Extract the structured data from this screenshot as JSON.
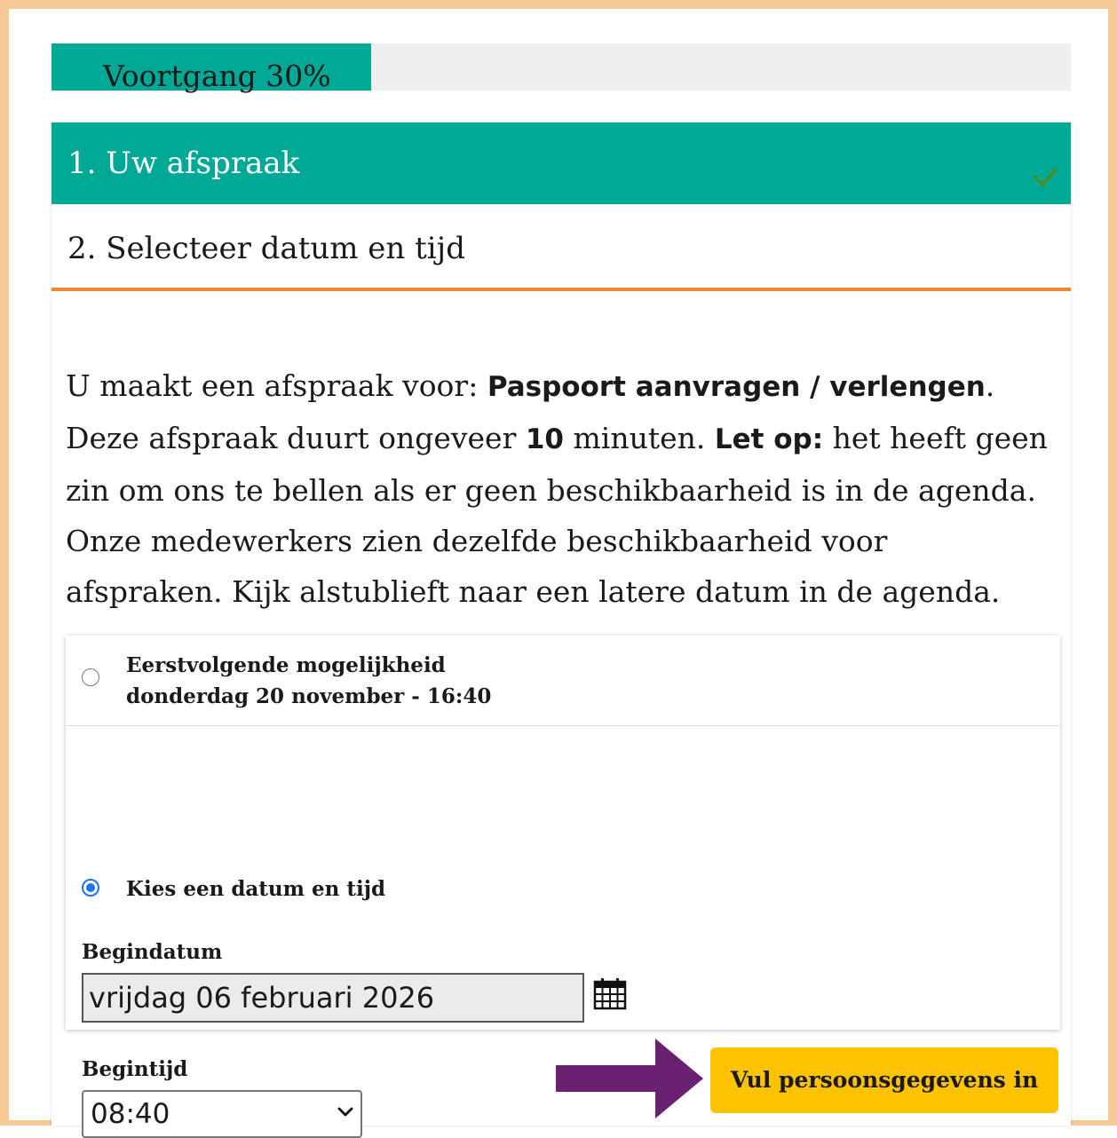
{
  "progress": {
    "label": "Voortgang 30%",
    "percent": 30
  },
  "steps": {
    "step1_label": "1. Uw afspraak",
    "step1_status": "completed",
    "step2_label": "2. Selecteer datum en tijd"
  },
  "intro": {
    "part1": "U maakt een afspraak voor: ",
    "service": "Paspoort aanvragen / verlengen",
    "part2": ". Deze afspraak duurt ongeveer ",
    "duration": "10",
    "part3": " minuten. ",
    "note_label": "Let op:",
    "part4": " het heeft geen zin om ons te bellen als er geen beschikbaarheid is in de agenda. Onze medewerkers zien dezelfde beschikbaarheid voor afspraken. Kijk alstublieft naar een latere datum in de agenda."
  },
  "options": {
    "first_available_title": "Eerstvolgende mogelijkheid",
    "first_available_datetime": "donderdag 20 november - 16:40",
    "choose_label": "Kies een datum en tijd",
    "selected": "choose"
  },
  "form": {
    "start_date_label": "Begindatum",
    "start_date_value": "vrijdag 06 februari 2026",
    "start_time_label": "Begintijd",
    "start_time_value": "08:40"
  },
  "actions": {
    "next_label": "Vul persoonsgegevens in"
  },
  "colors": {
    "teal": "#00a896",
    "orange_border": "#f6c995",
    "step_underline": "#f08632",
    "button_yellow": "#fdc300",
    "arrow_purple": "#6b2172",
    "radio_blue": "#1a73e8"
  }
}
